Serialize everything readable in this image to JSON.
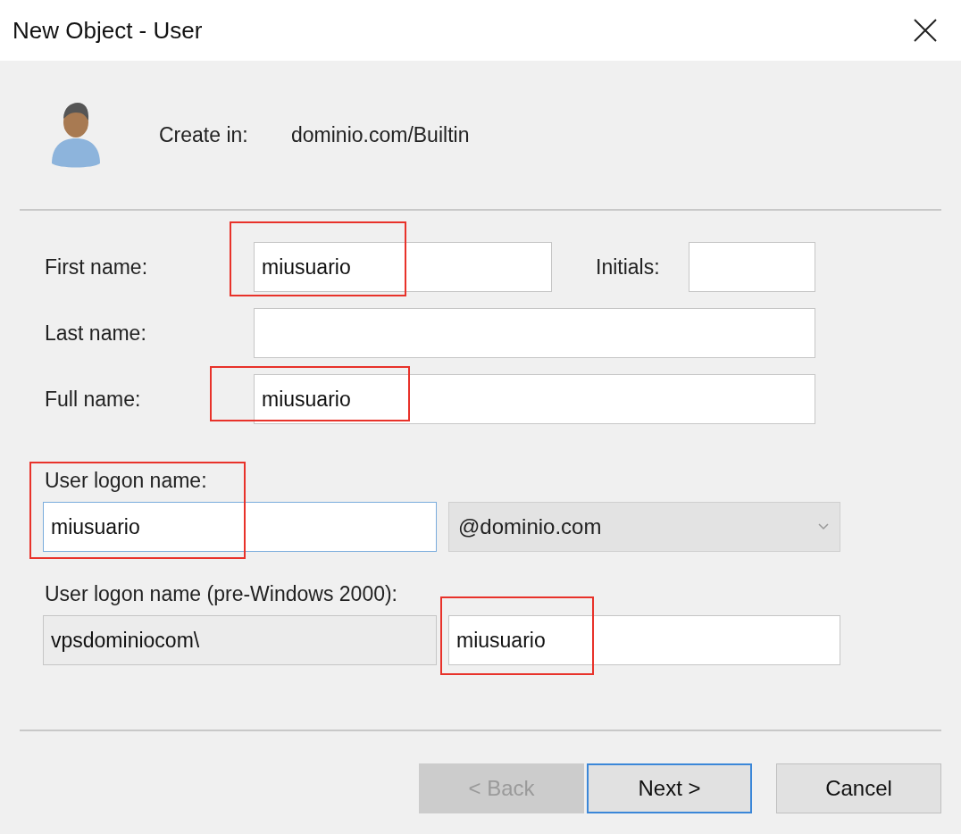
{
  "window": {
    "title": "New Object - User"
  },
  "header": {
    "label": "Create in:",
    "value": "dominio.com/Builtin"
  },
  "first_name": {
    "label": "First name:",
    "value": "miusuario",
    "annotated": true
  },
  "initials": {
    "label": "Initials:"
  },
  "last_name": {
    "label": "Last name:"
  },
  "full_name": {
    "label": "Full name:",
    "value": "miusuario",
    "annotated": true
  },
  "logon": {
    "label": "User logon name:",
    "value": "miusuario",
    "focused": true,
    "annotated": true,
    "domain": "@dominio.com"
  },
  "pre2000": {
    "label": "User logon name (pre-Windows 2000):",
    "prefix": "vpsdominiocom\\",
    "value": "miusuario",
    "annotated": true
  },
  "buttons": [
    {
      "label": "< Back",
      "disabled": true,
      "default": false
    },
    {
      "label": "Next >",
      "disabled": false,
      "default": true
    },
    {
      "label": "Cancel",
      "disabled": false,
      "default": false
    }
  ]
}
